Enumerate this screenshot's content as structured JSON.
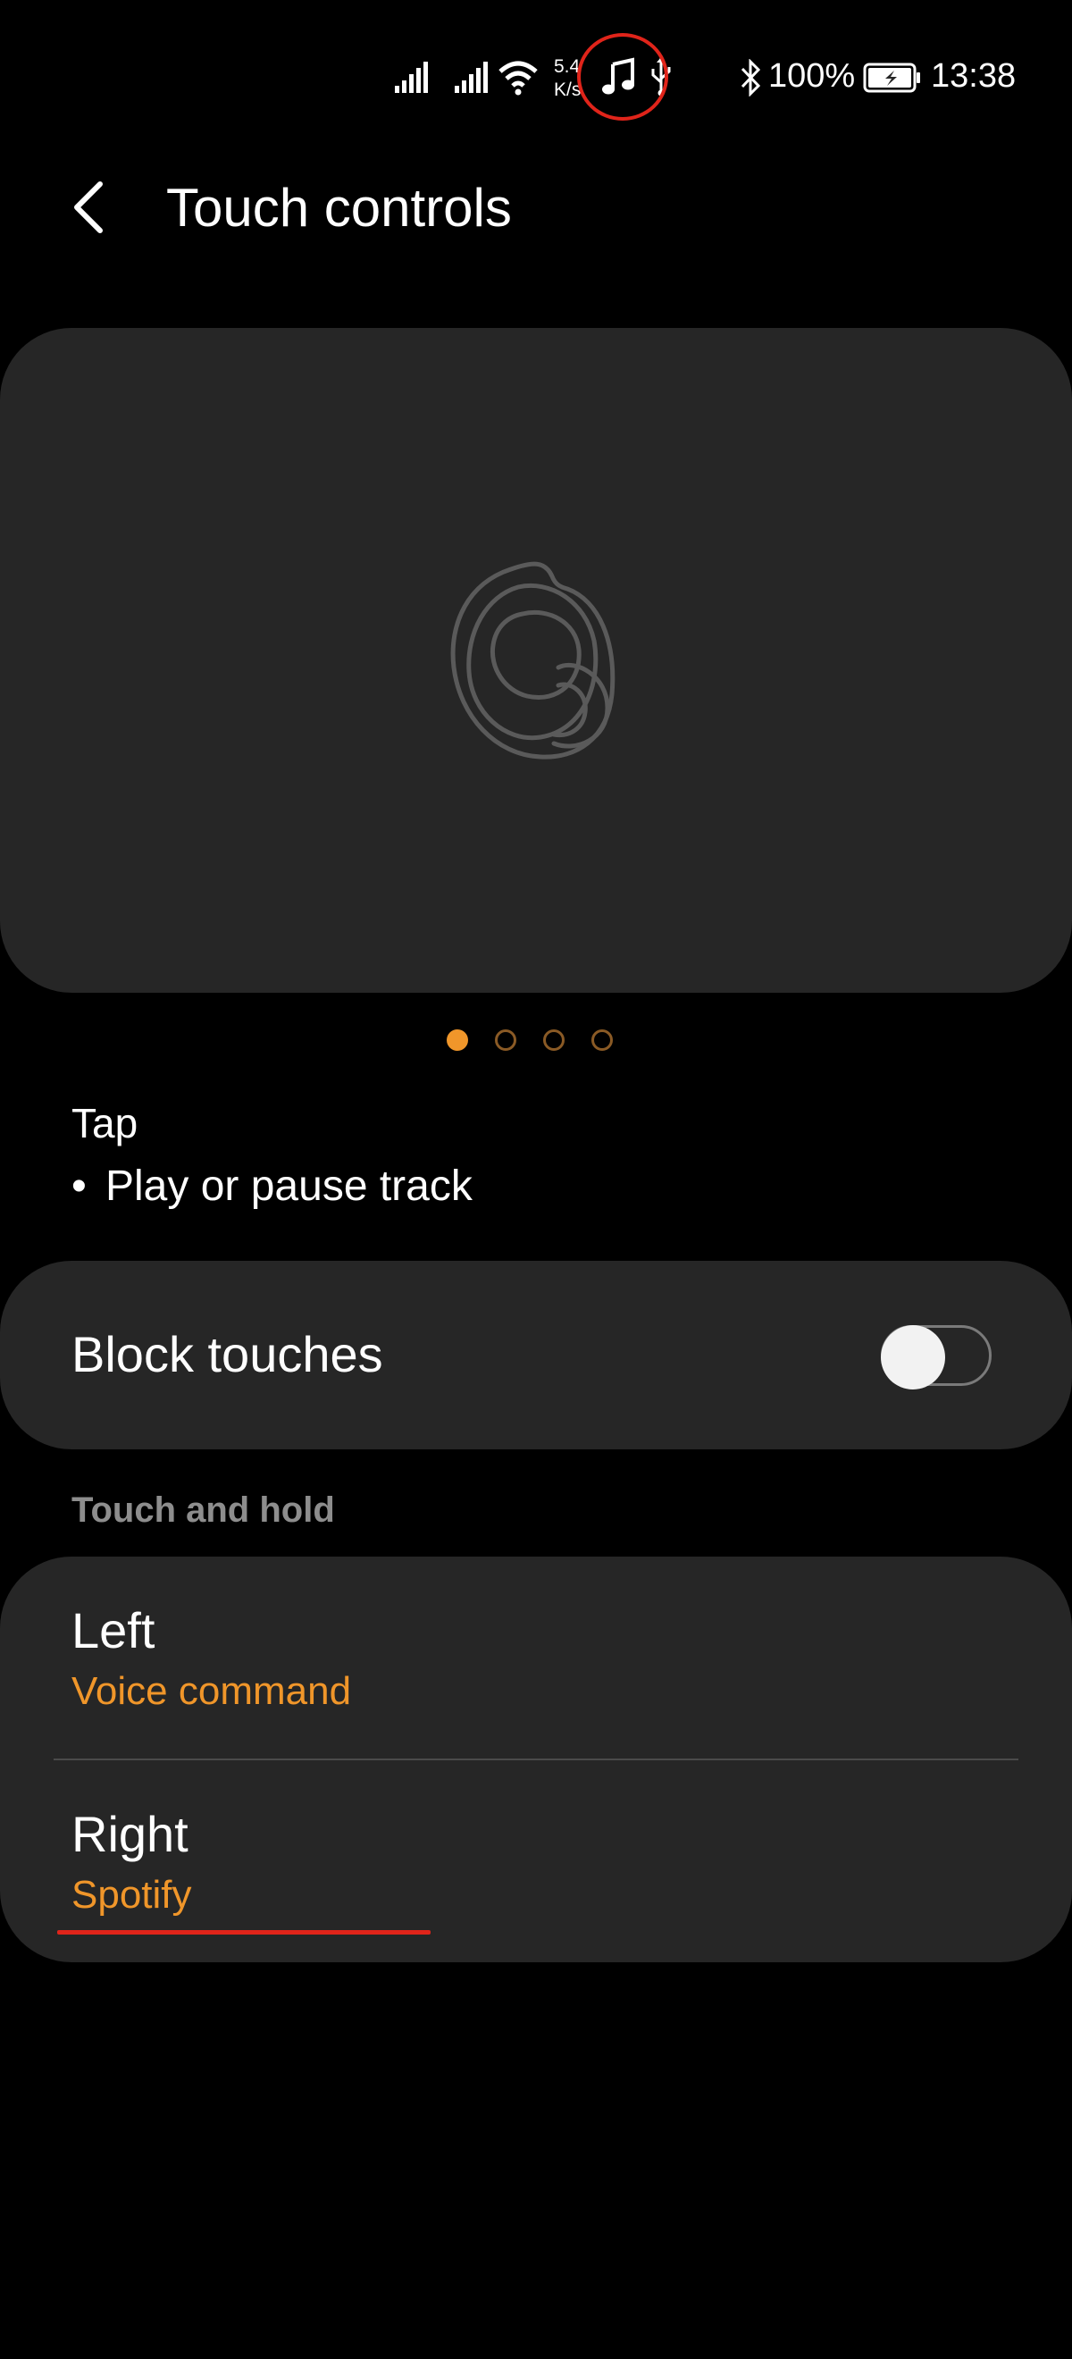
{
  "status_bar": {
    "network_speed": "5.4\nK/s",
    "battery_percent": "100%",
    "time": "13:38"
  },
  "header": {
    "title": "Touch controls"
  },
  "pager": {
    "count": 4,
    "active_index": 0
  },
  "tap": {
    "title": "Tap",
    "action": "Play or pause track"
  },
  "block_touches": {
    "label": "Block touches",
    "enabled": false
  },
  "touch_and_hold": {
    "header": "Touch and hold",
    "left": {
      "title": "Left",
      "value": "Voice command"
    },
    "right": {
      "title": "Right",
      "value": "Spotify"
    }
  },
  "colors": {
    "accent": "#f0962a",
    "card": "#262626",
    "annotation": "#e0241a"
  }
}
